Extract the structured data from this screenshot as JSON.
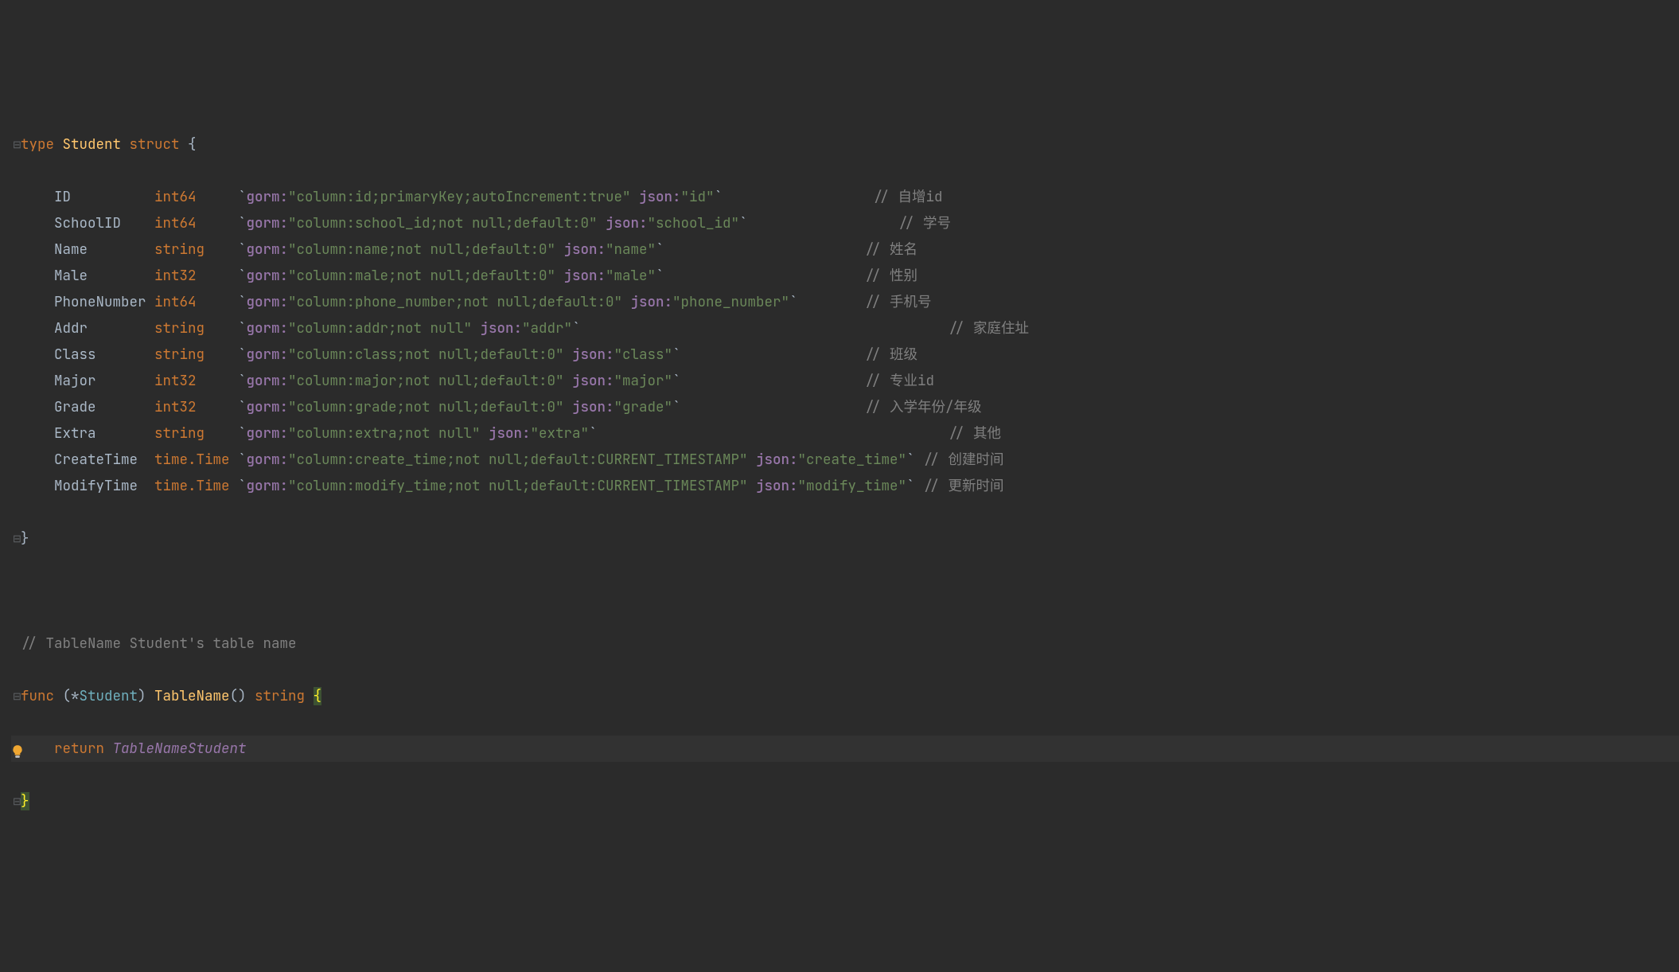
{
  "code": {
    "struct_decl": {
      "kw_type": "type",
      "name": "Student",
      "kw_struct": "struct",
      "brace_open": "{"
    },
    "fields": [
      {
        "name": "ID",
        "type": "int64",
        "tag_gorm_key": "gorm:",
        "tag_gorm_val": "\"column:id;primaryKey;autoIncrement:true\"",
        "tag_json_key": "json:",
        "tag_json_val": "\"id\"",
        "pad": "                  ",
        "comment": "// 自增id"
      },
      {
        "name": "SchoolID",
        "type": "int64",
        "tag_gorm_key": "gorm:",
        "tag_gorm_val": "\"column:school_id;not null;default:0\"",
        "tag_json_key": "json:",
        "tag_json_val": "\"school_id\"",
        "pad": "                  ",
        "comment": "// 学号"
      },
      {
        "name": "Name",
        "type": "string",
        "tag_gorm_key": "gorm:",
        "tag_gorm_val": "\"column:name;not null;default:0\"",
        "tag_json_key": "json:",
        "tag_json_val": "\"name\"",
        "pad": "                        ",
        "comment": "// 姓名"
      },
      {
        "name": "Male",
        "type": "int32",
        "tag_gorm_key": "gorm:",
        "tag_gorm_val": "\"column:male;not null;default:0\"",
        "tag_json_key": "json:",
        "tag_json_val": "\"male\"",
        "pad": "                        ",
        "comment": "// 性别"
      },
      {
        "name": "PhoneNumber",
        "type": "int64",
        "tag_gorm_key": "gorm:",
        "tag_gorm_val": "\"column:phone_number;not null;default:0\"",
        "tag_json_key": "json:",
        "tag_json_val": "\"phone_number\"",
        "pad": "        ",
        "comment": "// 手机号"
      },
      {
        "name": "Addr",
        "type": "string",
        "tag_gorm_key": "gorm:",
        "tag_gorm_val": "\"column:addr;not null\"",
        "tag_json_key": "json:",
        "tag_json_val": "\"addr\"",
        "pad": "                                            ",
        "comment": "// 家庭住址"
      },
      {
        "name": "Class",
        "type": "string",
        "tag_gorm_key": "gorm:",
        "tag_gorm_val": "\"column:class;not null;default:0\"",
        "tag_json_key": "json:",
        "tag_json_val": "\"class\"",
        "pad": "                      ",
        "comment": "// 班级"
      },
      {
        "name": "Major",
        "type": "int32",
        "tag_gorm_key": "gorm:",
        "tag_gorm_val": "\"column:major;not null;default:0\"",
        "tag_json_key": "json:",
        "tag_json_val": "\"major\"",
        "pad": "                      ",
        "comment": "// 专业id"
      },
      {
        "name": "Grade",
        "type": "int32",
        "tag_gorm_key": "gorm:",
        "tag_gorm_val": "\"column:grade;not null;default:0\"",
        "tag_json_key": "json:",
        "tag_json_val": "\"grade\"",
        "pad": "                      ",
        "comment": "// 入学年份/年级"
      },
      {
        "name": "Extra",
        "type": "string",
        "tag_gorm_key": "gorm:",
        "tag_gorm_val": "\"column:extra;not null\"",
        "tag_json_key": "json:",
        "tag_json_val": "\"extra\"",
        "pad": "                                          ",
        "comment": "// 其他"
      },
      {
        "name": "CreateTime",
        "type": "time.Time",
        "tag_gorm_key": "gorm:",
        "tag_gorm_val": "\"column:create_time;not null;default:CURRENT_TIMESTAMP\"",
        "tag_json_key": "json:",
        "tag_json_val": "\"create_time\"",
        "pad": " ",
        "comment": "// 创建时间"
      },
      {
        "name": "ModifyTime",
        "type": "time.Time",
        "tag_gorm_key": "gorm:",
        "tag_gorm_val": "\"column:modify_time;not null;default:CURRENT_TIMESTAMP\"",
        "tag_json_key": "json:",
        "tag_json_val": "\"modify_time\"",
        "pad": " ",
        "comment": "// 更新时间"
      }
    ],
    "brace_close": "}",
    "blank": "",
    "comment_table": "// TableName Student's table name",
    "func_line": {
      "kw_func": "func",
      "recv_open": "(*",
      "recv_type": "Student",
      "recv_close": ")",
      "fn_name": "TableName",
      "parens": "()",
      "ret_type": "string",
      "brace": "{"
    },
    "return_line": {
      "kw_return": "return",
      "val": "TableNameStudent"
    },
    "func_close": "}"
  },
  "layout": {
    "name_col_width": 12,
    "type_col_width": 10
  }
}
